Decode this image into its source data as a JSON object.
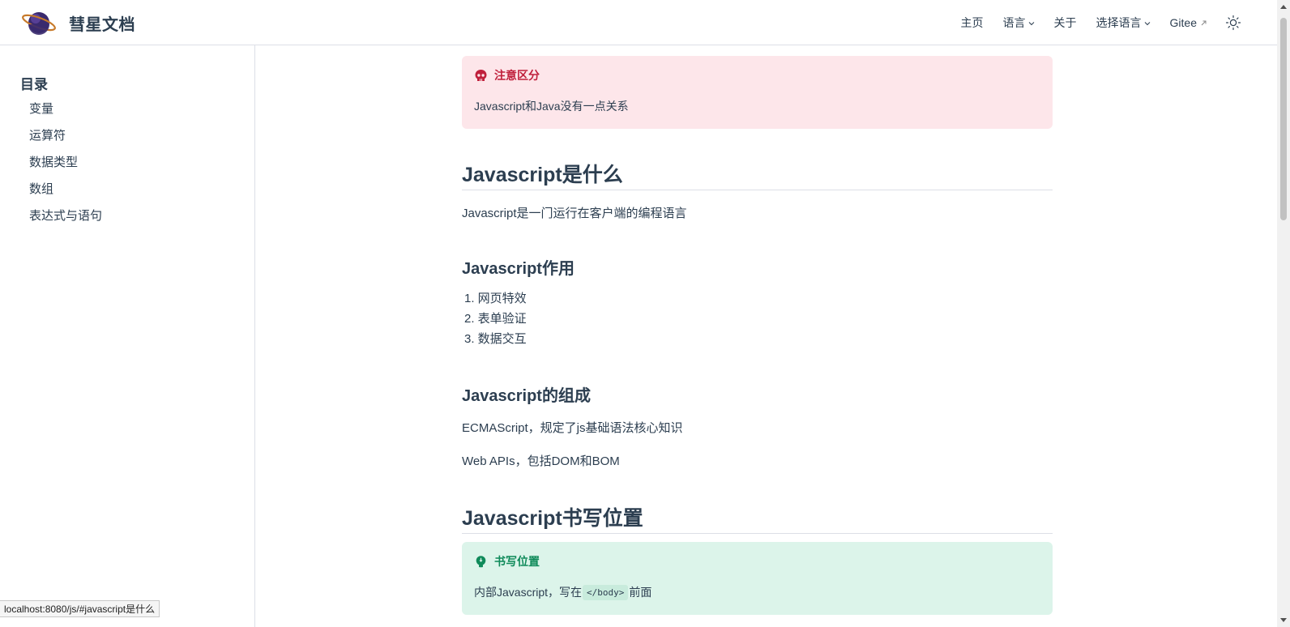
{
  "navbar": {
    "site_title": "彗星文档",
    "links": [
      {
        "label": "主页"
      },
      {
        "label": "语言"
      },
      {
        "label": "关于"
      },
      {
        "label": "选择语言"
      },
      {
        "label": "Gitee"
      }
    ]
  },
  "sidebar": {
    "title": "目录",
    "items": [
      "变量",
      "运算符",
      "数据类型",
      "数组",
      "表达式与语句"
    ]
  },
  "content": {
    "danger_hint": {
      "title": "注意区分",
      "body": "Javascript和Java没有一点关系"
    },
    "section1": {
      "heading": "Javascript是什么",
      "paragraph": "Javascript是一门运行在客户端的编程语言"
    },
    "section_usage": {
      "heading": "Javascript作用",
      "items": [
        "1. 网页特效",
        "2. 表单验证",
        "3. 数据交互"
      ]
    },
    "section_composition": {
      "heading": "Javascript的组成",
      "p1": "ECMAScript，规定了js基础语法核心知识",
      "p2": "Web APIs，包括DOM和BOM"
    },
    "section2": {
      "heading": "Javascript书写位置"
    },
    "tip_hint": {
      "title": "书写位置",
      "body_prefix": "内部Javascript，写在",
      "code": "</body>",
      "body_suffix": "前面"
    }
  },
  "statusbar": {
    "url": "localhost:8080/js/#javascript是什么"
  },
  "colors": {
    "danger_bg": "#fde6ea",
    "danger_title": "#c0203c",
    "tip_bg": "#dcf4ea",
    "tip_title": "#0f8a5a",
    "text": "#2c3e50"
  }
}
